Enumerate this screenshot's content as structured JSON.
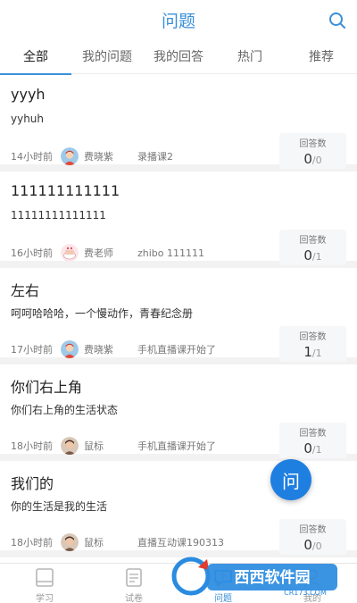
{
  "header": {
    "title": "问题"
  },
  "tabs": [
    {
      "label": "全部",
      "active": true
    },
    {
      "label": "我的问题"
    },
    {
      "label": "我的回答"
    },
    {
      "label": "热门"
    },
    {
      "label": "推荐"
    }
  ],
  "questions": [
    {
      "title": "yyyh",
      "body": "yyhuh",
      "time": "14小时前",
      "author": "费晓紫",
      "course": "录播课2",
      "stat_label": "回答数",
      "answered": "0",
      "sep": "/",
      "total": "0"
    },
    {
      "title": "111111111111",
      "body": "11111111111111",
      "time": "16小时前",
      "author": "费老师",
      "course": "zhibo 111111",
      "stat_label": "回答数",
      "answered": "0",
      "sep": "/",
      "total": "1"
    },
    {
      "title": "左右",
      "body": "呵呵哈哈哈，一个慢动作，青春纪念册",
      "time": "17小时前",
      "author": "费晓紫",
      "course": "手机直播课开始了",
      "stat_label": "回答数",
      "answered": "1",
      "sep": "/",
      "total": "1"
    },
    {
      "title": "你们右上角",
      "body": "你们右上角的生活状态",
      "time": "18小时前",
      "author": "鼠标",
      "course": "手机直播课开始了",
      "stat_label": "回答数",
      "answered": "0",
      "sep": "/",
      "total": "1"
    },
    {
      "title": "我们的",
      "body": "你的生活是我的生活",
      "time": "18小时前",
      "author": "鼠标",
      "course": "直播互动课190313",
      "stat_label": "回答数",
      "answered": "0",
      "sep": "/",
      "total": "0"
    }
  ],
  "fab": {
    "label": "问"
  },
  "bottom_nav": [
    {
      "label": "学习",
      "icon": "book-icon"
    },
    {
      "label": "试卷",
      "icon": "paper-icon"
    },
    {
      "label": "问题",
      "icon": "question-icon",
      "active": true
    },
    {
      "label": "我的",
      "icon": "user-icon"
    }
  ],
  "watermark": {
    "text": "西西软件园",
    "sub": "CR173.COM"
  },
  "colors": {
    "accent": "#3a8fd8",
    "fab": "#1f7fe0"
  }
}
